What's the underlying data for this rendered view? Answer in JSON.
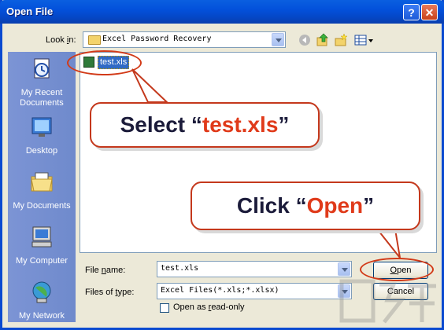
{
  "window": {
    "title": "Open File"
  },
  "title_buttons": {
    "help": "?",
    "close": "✕"
  },
  "look_in": {
    "label_prefix": "Look ",
    "label_underlined": "i",
    "label_suffix": "n:",
    "value": "Excel Password Recovery"
  },
  "places": [
    {
      "label": "My Recent Documents",
      "icon": "recent-documents-icon"
    },
    {
      "label": "Desktop",
      "icon": "desktop-icon"
    },
    {
      "label": "My Documents",
      "icon": "my-documents-icon"
    },
    {
      "label": "My Computer",
      "icon": "my-computer-icon"
    },
    {
      "label": "My Network",
      "icon": "my-network-icon"
    }
  ],
  "files": [
    {
      "name": "test.xls",
      "icon": "excel-file-icon",
      "selected": true
    }
  ],
  "file_name": {
    "label_prefix": "File ",
    "label_underlined": "n",
    "label_suffix": "ame:",
    "value": "test.xls"
  },
  "file_type": {
    "label_prefix": "Files of ",
    "label_underlined": "t",
    "label_suffix": "ype:",
    "value": "Excel Files(*.xls;*.xlsx)"
  },
  "read_only": {
    "label_prefix": "Open as ",
    "label_underlined": "r",
    "label_suffix": "ead-only",
    "checked": false
  },
  "buttons": {
    "open_underlined": "O",
    "open_rest": "pen",
    "cancel": "Cancel"
  },
  "callouts": {
    "select": {
      "prefix": "Select “",
      "highlight": "test.xls",
      "suffix": "”"
    },
    "click": {
      "prefix": "Click “",
      "highlight": "Open",
      "suffix": "”"
    }
  },
  "colors": {
    "title_bar": "#0a5fe0",
    "places_bar": "#6f8acc",
    "callout_border": "#c4381c",
    "callout_highlight": "#e03a1a",
    "selection": "#316ac5"
  }
}
